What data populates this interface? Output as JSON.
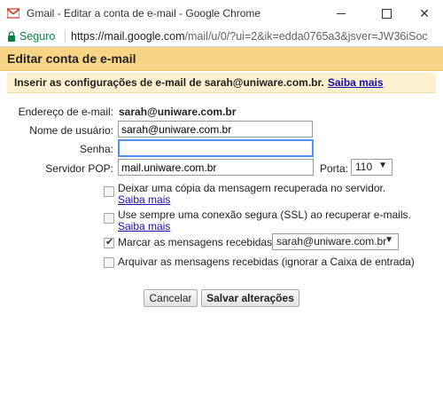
{
  "window": {
    "title": "Gmail - Editar a conta de e-mail - Google Chrome"
  },
  "addressbar": {
    "secure_label": "Seguro",
    "url_scheme_host": "https://mail.google.com",
    "url_path": "/mail/u/0/?ui=2&ik=edda0765a3&jsver=JW36iSoc"
  },
  "dialog": {
    "title": "Editar conta de e-mail",
    "instruction": "Inserir as configurações de e-mail de sarah@uniware.com.br.",
    "instruction_link": "Saiba mais"
  },
  "form": {
    "email_label": "Endereço de e-mail:",
    "email_value": "sarah@uniware.com.br",
    "username_label": "Nome de usuário:",
    "username_value": "sarah@uniware.com.br",
    "password_label": "Senha:",
    "password_value": "",
    "pop_label": "Servidor POP:",
    "pop_value": "mail.uniware.com.br",
    "port_label": "Porta:",
    "port_value": "110"
  },
  "options": [
    {
      "label": "Deixar uma cópia da mensagem recuperada no servidor.",
      "link": "Saiba mais",
      "checked": false
    },
    {
      "label": "Use sempre uma conexão segura (SSL) ao recuperar e-mails.",
      "link": "Saiba mais",
      "checked": false
    },
    {
      "label": "Marcar as mensagens recebidas:",
      "select_value": "sarah@uniware.com.br",
      "checked": true
    },
    {
      "label": "Arquivar as mensagens recebidas (ignorar a Caixa de entrada)",
      "checked": false
    }
  ],
  "buttons": {
    "cancel": "Cancelar",
    "save": "Salvar alterações"
  },
  "colors": {
    "header": "#f8d487",
    "instruction_bg": "#fdf0cf",
    "secure_green": "#0b8043",
    "link": "#1a0dab",
    "focus": "#4d90fe"
  }
}
